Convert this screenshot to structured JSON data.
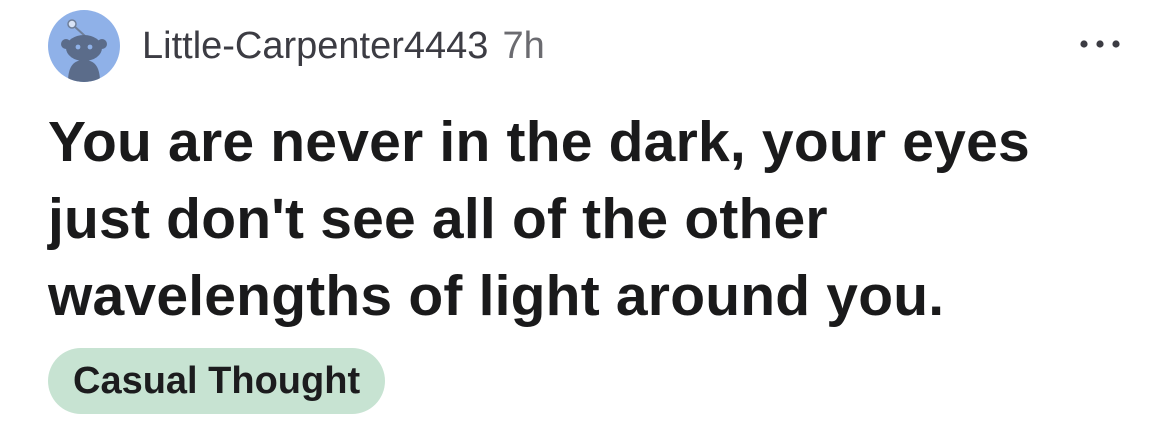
{
  "post": {
    "author": "Little-Carpenter4443",
    "age": "7h",
    "title": "You are never in the dark, your eyes just don't see all of the other wavelengths of light around you.",
    "flair": "Casual Thought",
    "more_icon": "ellipsis-horizontal-icon",
    "avatar_icon": "snoo-avatar-icon"
  },
  "colors": {
    "avatar_bg": "#8fb1e8",
    "flair_bg": "#c7e3d2",
    "title_text": "#1a1a1b"
  }
}
